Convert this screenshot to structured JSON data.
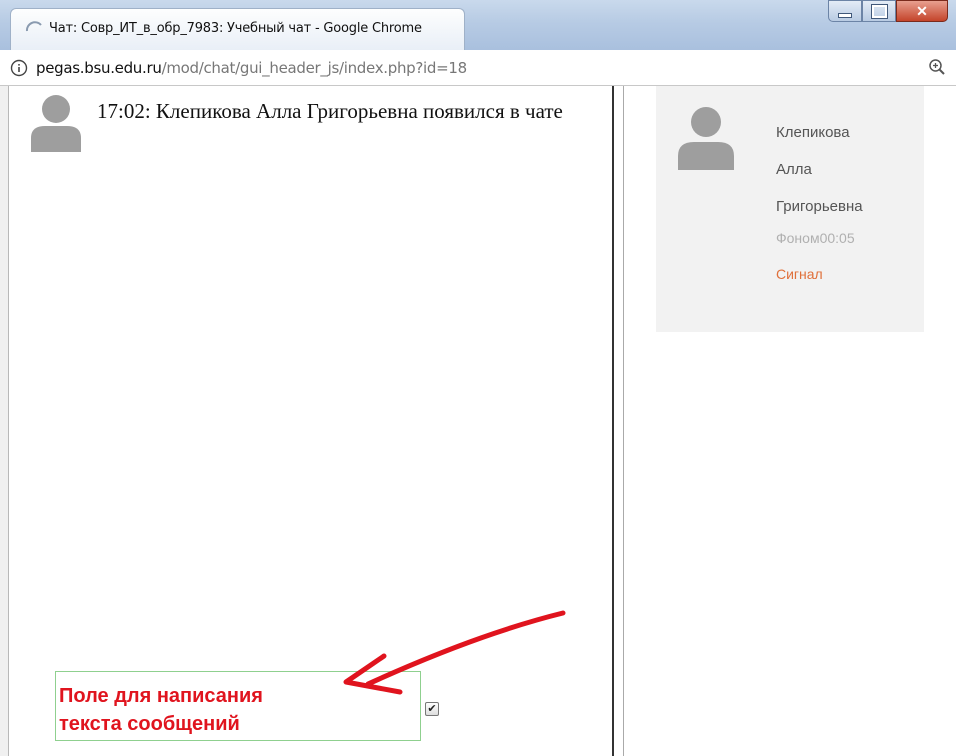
{
  "window": {
    "tab_title": "Чат: Совр_ИТ_в_обр_7983: Учебный чат - Google Chrome",
    "minimize_symbol": "–",
    "maximize_symbol": "□",
    "close_symbol": "✕"
  },
  "addressbar": {
    "host": "pegas.bsu.edu.ru",
    "path": "/mod/chat/gui_header_js/index.php?id=18",
    "info_icon": "info-icon",
    "zoom_icon": "zoom-in-icon"
  },
  "chat": {
    "messages": [
      {
        "time": "17:02",
        "text": "17:02: Клепикова Алла Григорьевна появился в чате"
      }
    ]
  },
  "users": [
    {
      "name_line1": "Клепикова",
      "name_line2": "Алла",
      "name_line3": "Григорьевна",
      "idle": "Фоном00:05",
      "beep": "Сигнал"
    }
  ],
  "input": {
    "hint": "Поле для написания текста сообщений",
    "hint_line1": "Поле для написания",
    "hint_line2": "текста сообщений",
    "checkbox_checked": true
  },
  "colors": {
    "hint": "#e0141e",
    "beep": "#e0703a",
    "input_border": "#8fd08f",
    "arrow": "#e0141e"
  }
}
